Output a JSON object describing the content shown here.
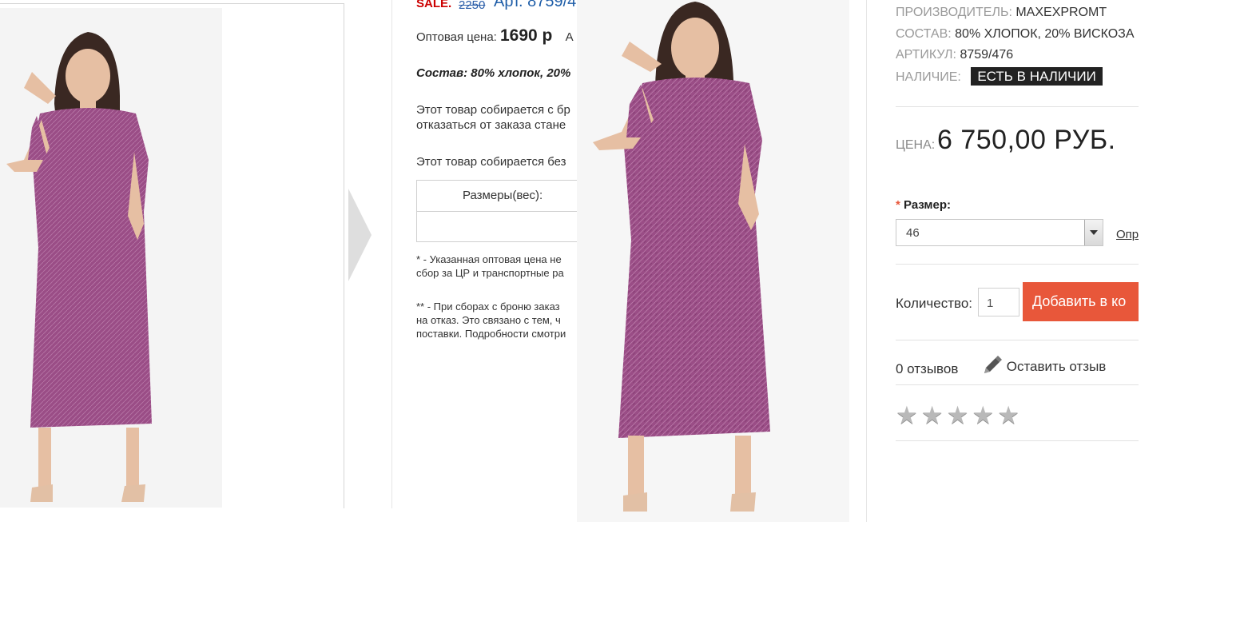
{
  "left_gallery": {
    "image_alt": "",
    "next_icon": "arrow-right"
  },
  "middle": {
    "sale_label": "SALE.",
    "old_price": "2250",
    "article": "Арт. 8759/4",
    "wholesale_label": "Оптовая цена:",
    "wholesale_price": "1690 р",
    "wholesale_tail": "А",
    "composition": "Состав: 80% хлопок, 20%",
    "booking_line1": "Этот товар собирается с бр",
    "booking_line2": "отказаться от заказа стане",
    "no_booking": "Этот товар собирается без",
    "sizes_header": "Размеры(вес):",
    "note1_line1": "* - Указанная оптовая цена не",
    "note1_line2": "сбор за ЦР и транспортные ра",
    "note2_line1": "** - При сборах с броню заказ",
    "note2_line2": "на отказ. Это связано с тем, ч",
    "note2_line3": "поставки. Подробности смотри"
  },
  "product": {
    "manufacturer_label": "ПРОИЗВОДИТЕЛЬ:",
    "manufacturer": "MAXEXPROMT",
    "composition_label": "СОСТАВ:",
    "composition": "80% ХЛОПОК, 20% ВИСКОЗА",
    "article_label": "АРТИКУЛ:",
    "article": "8759/476",
    "availability_label": "НАЛИЧИЕ:",
    "availability": "ЕСТЬ В НАЛИЧИИ",
    "price_label": "ЦЕНА:",
    "price": "6 750,00 РУБ.",
    "size_required_mark": "*",
    "size_label": "Размер:",
    "size_selected": "46",
    "size_guide_link": "Опр",
    "quantity_label": "Количество:",
    "quantity": "1",
    "add_to_cart": "Добавить в ко",
    "reviews_count": "0 отзывов",
    "leave_review": "Оставить отзыв",
    "rating": 0,
    "rating_max": 5
  },
  "colors": {
    "accent": "#e8573a",
    "sale": "#cc0000",
    "link": "#1f5ea8",
    "dress": "#9a4d86"
  }
}
